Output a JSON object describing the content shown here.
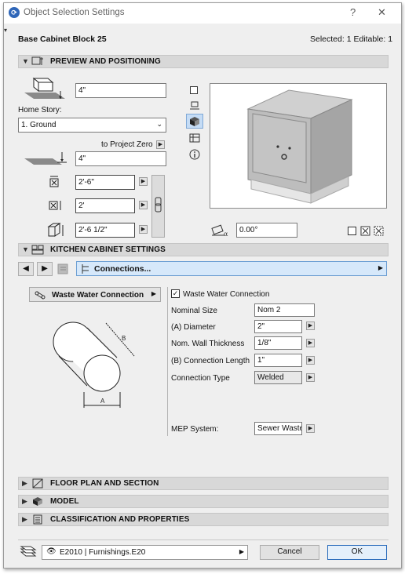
{
  "window": {
    "title": "Object Selection Settings",
    "help": "?",
    "close": "✕"
  },
  "header": {
    "object_name": "Base Cabinet Block 25",
    "selection_info": "Selected: 1 Editable: 1"
  },
  "sections": {
    "preview": "PREVIEW AND POSITIONING",
    "kitchen": "KITCHEN CABINET SETTINGS",
    "floorplan": "FLOOR PLAN AND SECTION",
    "model": "MODEL",
    "classification": "CLASSIFICATION AND PROPERTIES"
  },
  "preview": {
    "elevation_value": "4\"",
    "home_story_label": "Home Story:",
    "home_story_value": "1. Ground",
    "to_project_zero": "to Project Zero",
    "project_zero_value": "4\"",
    "width_value": "2'-6\"",
    "depth_value": "2'",
    "height_value": "2'-6 1/2\"",
    "rotation_value": "0.00°"
  },
  "kitchen": {
    "page_selector": "Connections...",
    "connection_button": "Waste Water Connection",
    "checkbox_label": "Waste Water Connection",
    "checkbox_checked": true,
    "fields": [
      {
        "label": "Nominal Size",
        "value": "Nom 2",
        "has_arrow": false
      },
      {
        "label": "(A) Diameter",
        "value": "2\"",
        "has_arrow": true
      },
      {
        "label": "Nom. Wall Thickness",
        "value": "1/8\"",
        "has_arrow": true
      },
      {
        "label": "(B) Connection Length",
        "value": "1\"",
        "has_arrow": true
      },
      {
        "label": "Connection Type",
        "value": "Welded",
        "has_arrow": true
      }
    ],
    "mep_label": "MEP System:",
    "mep_value": "Sewer Waste",
    "diagram_label_a": "A",
    "diagram_label_b": "B"
  },
  "footer": {
    "classification": "E2010 | Furnishings.E20",
    "cancel": "Cancel",
    "ok": "OK"
  }
}
